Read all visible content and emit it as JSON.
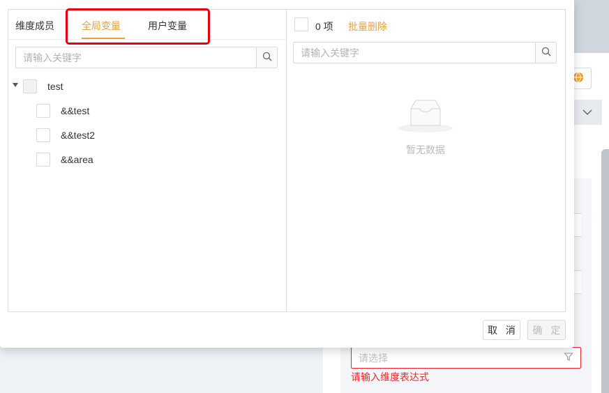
{
  "dialog": {
    "tabs": [
      {
        "label": "维度成员"
      },
      {
        "label": "全局变量",
        "active": true
      },
      {
        "label": "用户变量"
      }
    ],
    "left_search": {
      "placeholder": "请输入关键字",
      "value": ""
    },
    "tree": {
      "root": {
        "label": "test",
        "expanded": true,
        "checked": false
      },
      "children": [
        {
          "label": "&&test",
          "checked": false
        },
        {
          "label": "&&test2",
          "checked": false
        },
        {
          "label": "&&area",
          "checked": false
        }
      ]
    },
    "right": {
      "count_text": "0 项",
      "batch_delete_label": "批量删除",
      "search": {
        "placeholder": "请输入关键字",
        "value": ""
      },
      "empty_text": "暂无数据"
    },
    "footer": {
      "cancel_label": "取 消",
      "ok_label": "确 定"
    }
  },
  "background": {
    "select_placeholder": "请选择",
    "error_text": "请输入维度表达式"
  },
  "colors": {
    "accent": "#e6a23c",
    "error": "#f5222d",
    "annotation": "#e60012",
    "border": "#dcdfe6"
  }
}
